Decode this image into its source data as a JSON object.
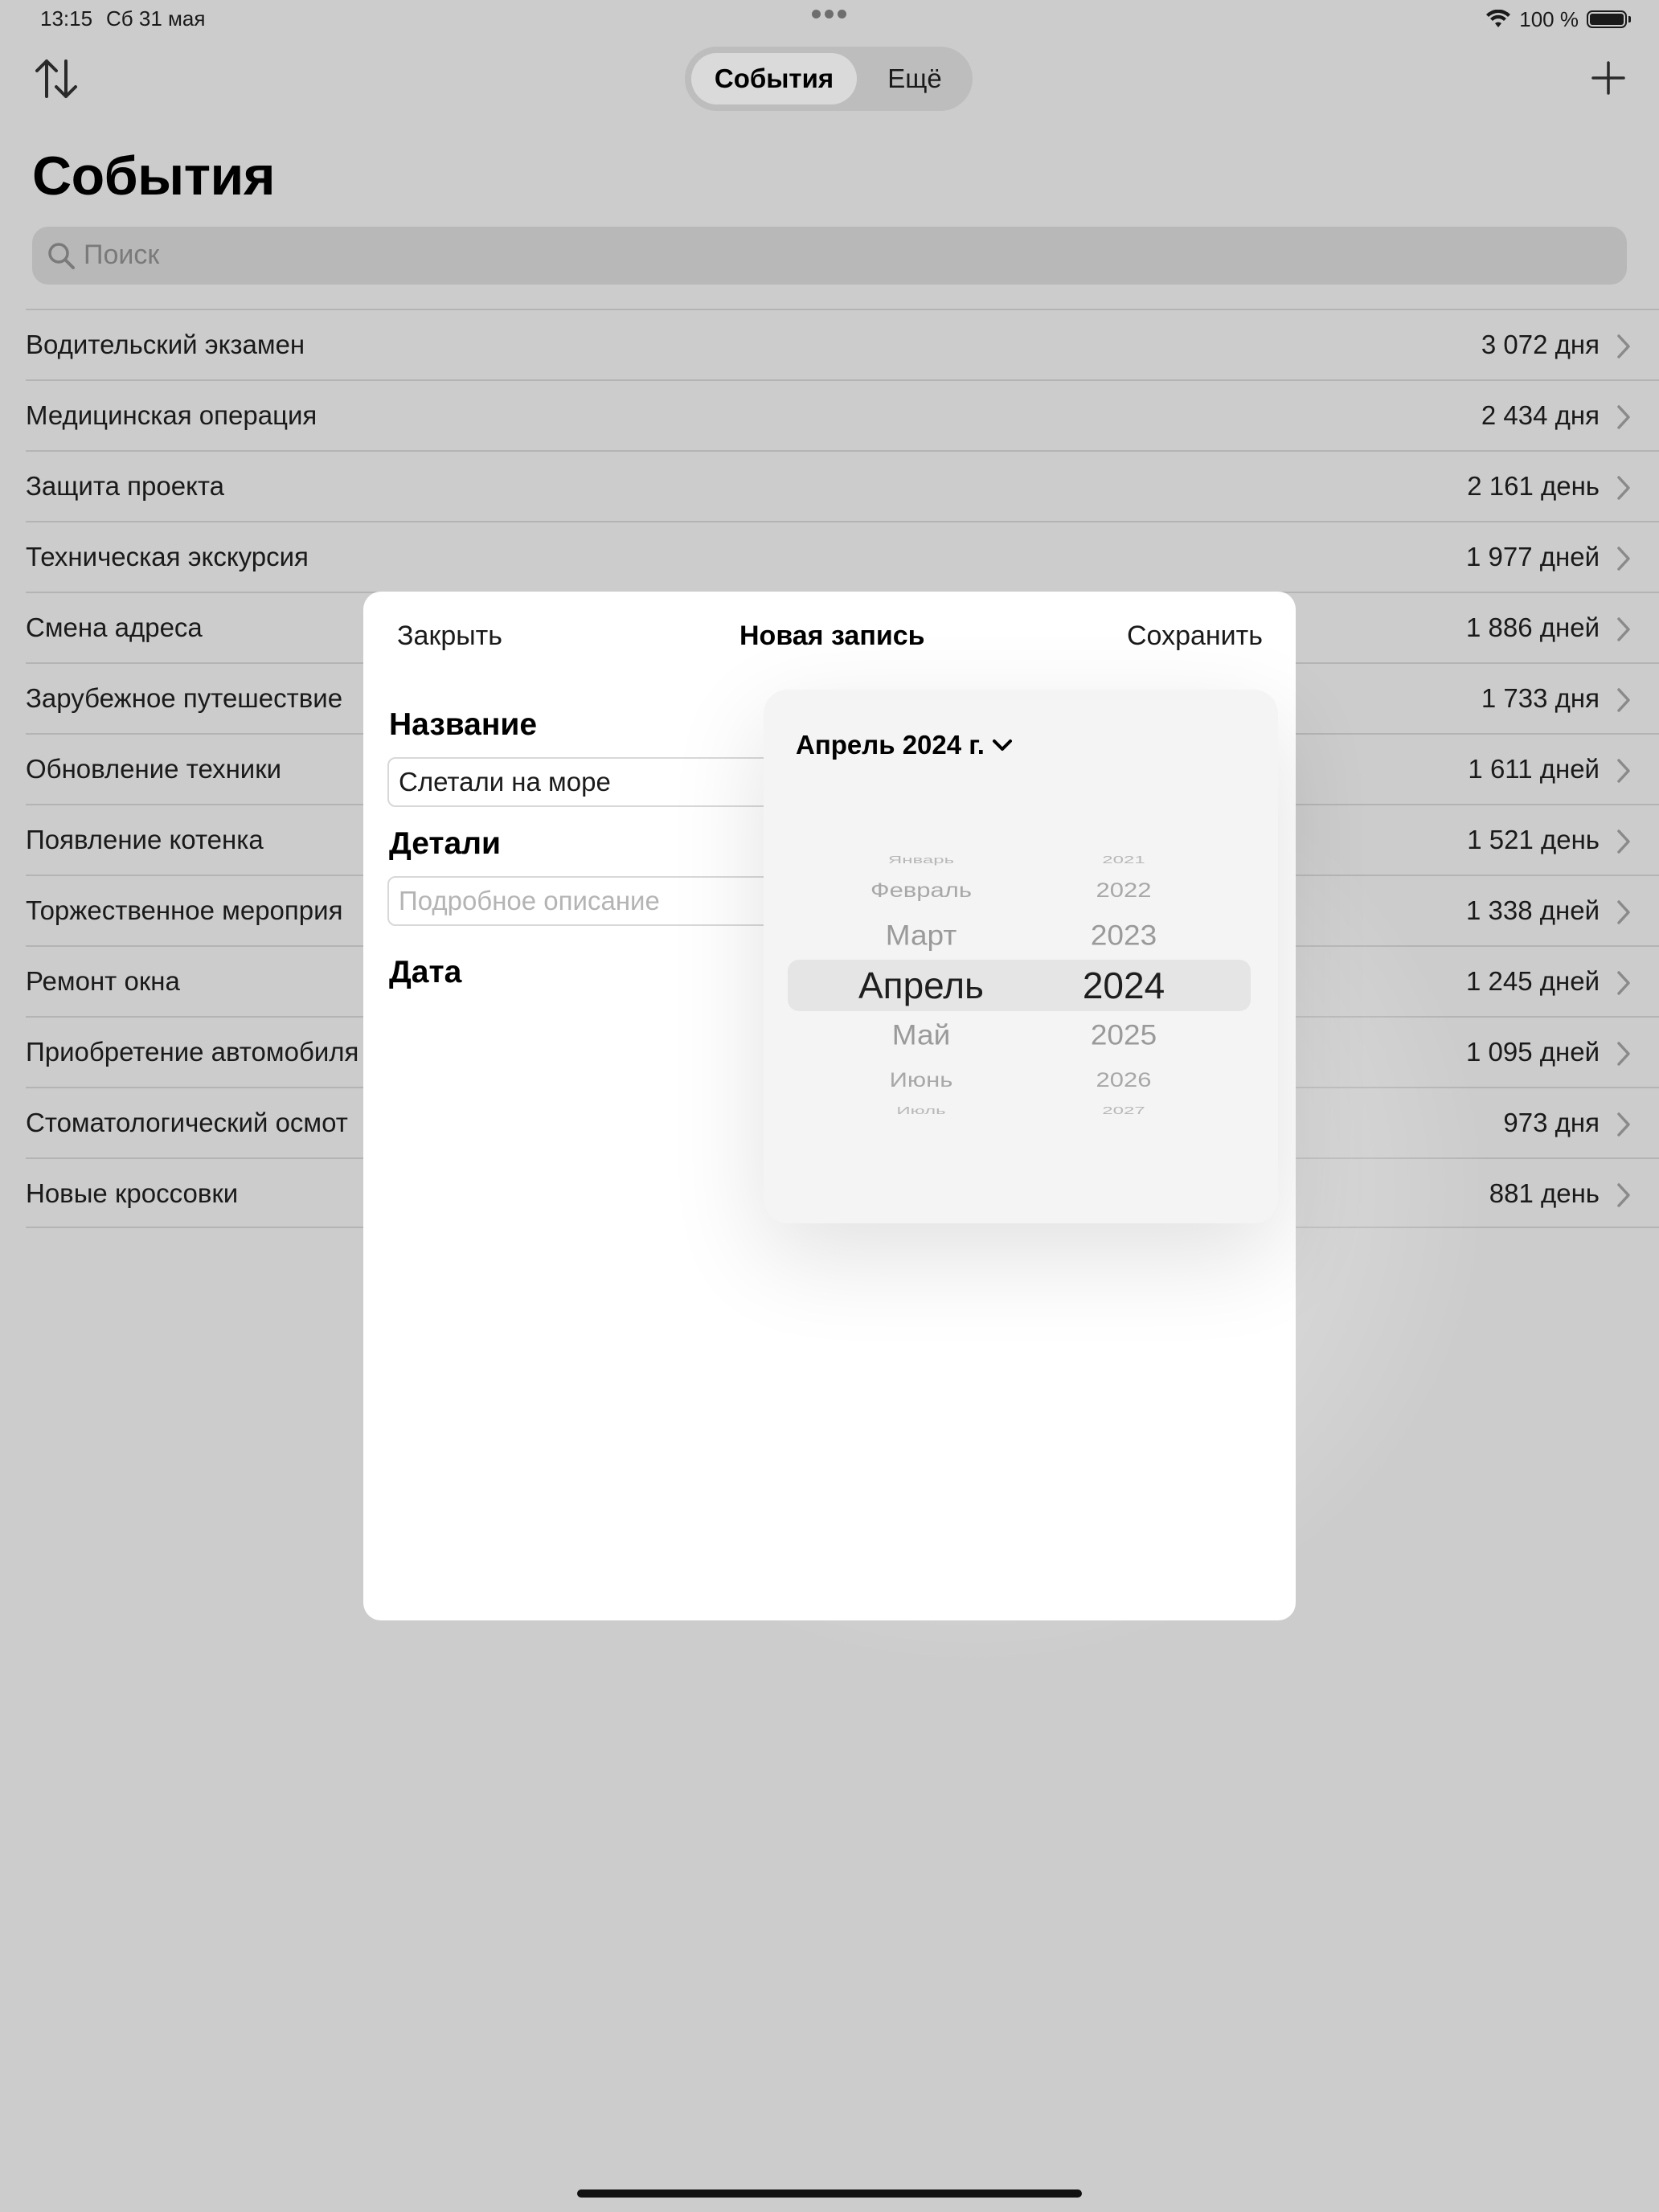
{
  "status_bar": {
    "time": "13:15",
    "date": "Сб 31 мая",
    "battery": "100 %"
  },
  "nav": {
    "segments": [
      "События",
      "Ещё"
    ],
    "selected_segment": "События",
    "sort_icon": "sort-arrows-icon",
    "add_icon": "plus-icon"
  },
  "page": {
    "title": "События",
    "search_placeholder": "Поиск"
  },
  "events": [
    {
      "name": "Водительский экзамен",
      "count": "3 072 дня"
    },
    {
      "name": "Медицинская операция",
      "count": "2 434 дня"
    },
    {
      "name": "Защита проекта",
      "count": "2 161 день"
    },
    {
      "name": "Техническая экскурсия",
      "count": "1 977 дней"
    },
    {
      "name": "Смена адреса",
      "count": "1 886 дней"
    },
    {
      "name": "Зарубежное путешествие",
      "count": "1 733 дня"
    },
    {
      "name": "Обновление техники",
      "count": "1 611 дней"
    },
    {
      "name": "Появление котенка",
      "count": "1 521 день"
    },
    {
      "name": "Торжественное мероприя",
      "count": "1 338 дней"
    },
    {
      "name": "Ремонт окна",
      "count": "1 245 дней"
    },
    {
      "name": "Приобретение автомобиля",
      "count": "1 095 дней"
    },
    {
      "name": "Стоматологический осмот",
      "count": "973 дня"
    },
    {
      "name": "Новые кроссовки",
      "count": "881 день"
    }
  ],
  "modal": {
    "close": "Закрыть",
    "title": "Новая запись",
    "save": "Сохранить",
    "name_label": "Название",
    "name_value": "Слетали на море",
    "details_label": "Детали",
    "details_placeholder": "Подробное описание",
    "date_label": "Дата"
  },
  "date_picker": {
    "header": "Апрель 2024 г.",
    "months": [
      "Январь",
      "Февраль",
      "Март",
      "Апрель",
      "Май",
      "Июнь",
      "Июль"
    ],
    "years": [
      "2021",
      "2022",
      "2023",
      "2024",
      "2025",
      "2026",
      "2027"
    ],
    "selected_month": "Апрель",
    "selected_year": "2024"
  }
}
